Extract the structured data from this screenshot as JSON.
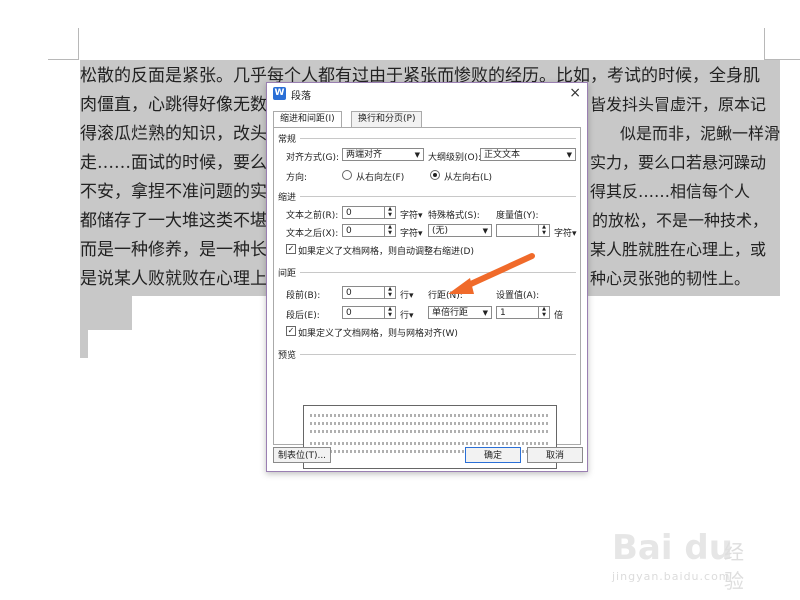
{
  "document": {
    "lines": [
      "松散的反面是紧张。几乎每个人都有过由于紧张而惨败的经历。比如，考试的时候，全身肌",
      "肉僵直，心跳得好像无数",
      "得滚瓜烂熟的知识，改头",
      "走……面试的时候，要么",
      "不安，拿捏不准问题的实",
      "都储存了一大堆这类不堪",
      "而是一种修养，是一种长",
      "是说某人败就败在心理上"
    ],
    "right_fragments": [
      "皆发抖头冒虚汗，原本记",
      "似是而非，泥鳅一样滑",
      "实力，要么口若悬河躁动",
      "得其反……相信每个人",
      "的放松，不是一种技术，",
      "某人胜就胜在心理上，或",
      "种心灵张弛的韧性上。"
    ]
  },
  "dialog": {
    "title": "段落",
    "app_icon_letter": "W",
    "close_symbol": "×",
    "tabs": [
      {
        "label": "缩进和间距(I)",
        "active": true
      },
      {
        "label": "换行和分页(P)",
        "active": false
      }
    ],
    "general": {
      "section_label": "常规",
      "alignment_label": "对齐方式(G):",
      "alignment_value": "两端对齐",
      "outline_label": "大纲级别(O):",
      "outline_value": "正文文本",
      "direction_label": "方向:",
      "rtl_label": "从右向左(F)",
      "ltr_label": "从左向右(L)",
      "direction_selected": "ltr"
    },
    "indent": {
      "section_label": "缩进",
      "before_label": "文本之前(R):",
      "before_value": "0",
      "before_unit": "字符",
      "special_label": "特殊格式(S):",
      "special_value": "(无)",
      "measure_label": "度量值(Y):",
      "measure_value": "",
      "measure_unit": "字符",
      "after_label": "文本之后(X):",
      "after_value": "0",
      "after_unit": "字符",
      "auto_adjust_label": "如果定义了文档网格，则自动调整右缩进(D)",
      "auto_adjust_checked": true
    },
    "spacing": {
      "section_label": "间距",
      "before_label": "段前(B):",
      "before_value": "0",
      "before_unit": "行",
      "after_label": "段后(E):",
      "after_value": "0",
      "after_unit": "行",
      "line_spacing_label": "行距(N):",
      "line_spacing_value": "单倍行距",
      "set_value_label": "设置值(A):",
      "set_value": "1",
      "set_value_unit": "倍",
      "snap_grid_label": "如果定义了文档网格，则与网格对齐(W)",
      "snap_grid_checked": true
    },
    "preview": {
      "section_label": "预览"
    },
    "buttons": {
      "tabs_label": "制表位(T)...",
      "ok_label": "确定",
      "cancel_label": "取消"
    }
  },
  "colors": {
    "annotation_arrow": "#f06a2a",
    "selection_bg": "#c8c8c8"
  },
  "watermark": {
    "main": "Bai du",
    "cn": "经验",
    "sub": "jingyan.baidu.com"
  }
}
